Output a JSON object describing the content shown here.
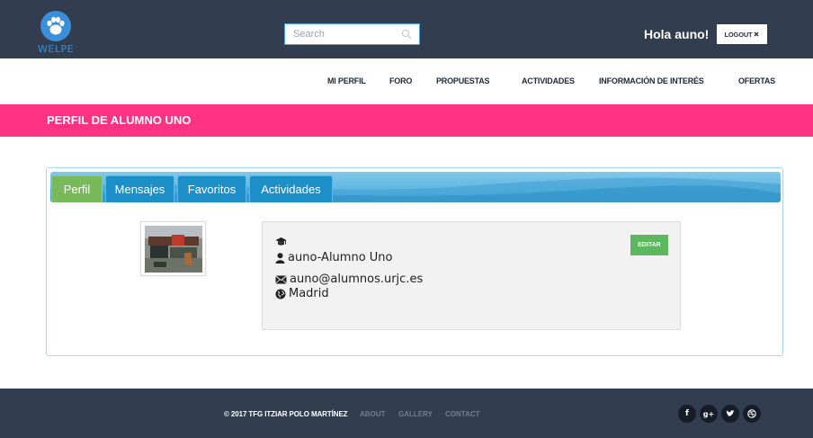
{
  "header": {
    "logo_text": "WELPE",
    "search_placeholder": "Search",
    "greeting": "Hola auno!",
    "logout_label": "LOGOUT"
  },
  "nav": {
    "items": [
      "MI PERFIL",
      "FORO",
      "PROPUESTAS",
      "ACTIVIDADES",
      "INFORMACIÓN DE INTERÉS",
      "OFERTAS"
    ]
  },
  "banner": {
    "title": "PERFIL DE ALUMNO UNO"
  },
  "tabs": [
    "Perfil",
    "Mensajes",
    "Favoritos",
    "Actividades"
  ],
  "active_tab": "Perfil",
  "profile": {
    "edit_label": "EDITAR",
    "name": "auno-Alumno Uno",
    "email": "auno@alumnos.urjc.es",
    "location": "Madrid"
  },
  "footer": {
    "copyright": "© 2017 TFG ITZIAR POLO MARTÍNEZ",
    "links": [
      "ABOUT",
      "GALLERY",
      "CONTACT"
    ],
    "social": [
      "facebook-icon",
      "google-plus-icon",
      "twitter-icon",
      "dribbble-icon"
    ]
  },
  "colors": {
    "topbar": "#323d4f",
    "banner": "#fe3382",
    "active_tab": "#78b95a",
    "tab": "#1c8fc9",
    "edit_button": "#5cb85c",
    "logo": "#3a8fd8"
  }
}
